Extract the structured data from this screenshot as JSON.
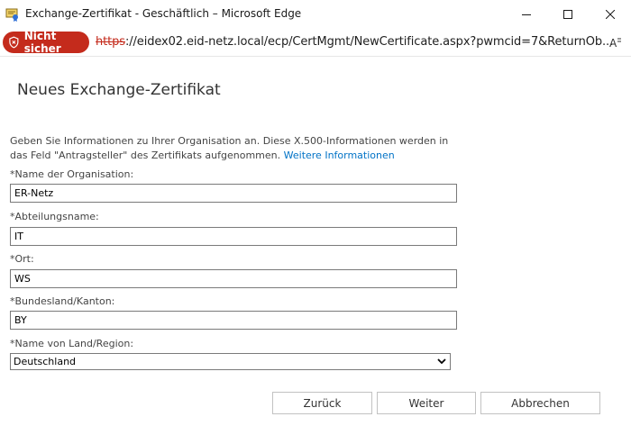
{
  "window": {
    "title": "Exchange-Zertifikat - Geschäftlich – Microsoft Edge"
  },
  "address_bar": {
    "security_label": "Nicht sicher",
    "url_scheme": "https",
    "url_rest": "://eidex02.eid-netz.local/ecp/CertMgmt/NewCertificate.aspx?pwmcid=7&ReturnOb..."
  },
  "page": {
    "title": "Neues Exchange-Zertifikat",
    "intro_text": "Geben Sie Informationen zu Ihrer Organisation an. Diese X.500-Informationen werden in das Feld \"Antragsteller\" des Zertifikats aufgenommen.",
    "intro_link": "Weitere Informationen"
  },
  "form": {
    "organization": {
      "label": "*Name der Organisation:",
      "value": "ER-Netz"
    },
    "department": {
      "label": "*Abteilungsname:",
      "value": "IT"
    },
    "city": {
      "label": "*Ort:",
      "value": "WS"
    },
    "state": {
      "label": "*Bundesland/Kanton:",
      "value": "BY"
    },
    "country": {
      "label": "*Name von Land/Region:",
      "selected": "Deutschland"
    }
  },
  "buttons": {
    "back": "Zurück",
    "next": "Weiter",
    "cancel": "Abbrechen"
  },
  "colors": {
    "not_secure_bg": "#c42b1c",
    "link": "#0072c6"
  }
}
